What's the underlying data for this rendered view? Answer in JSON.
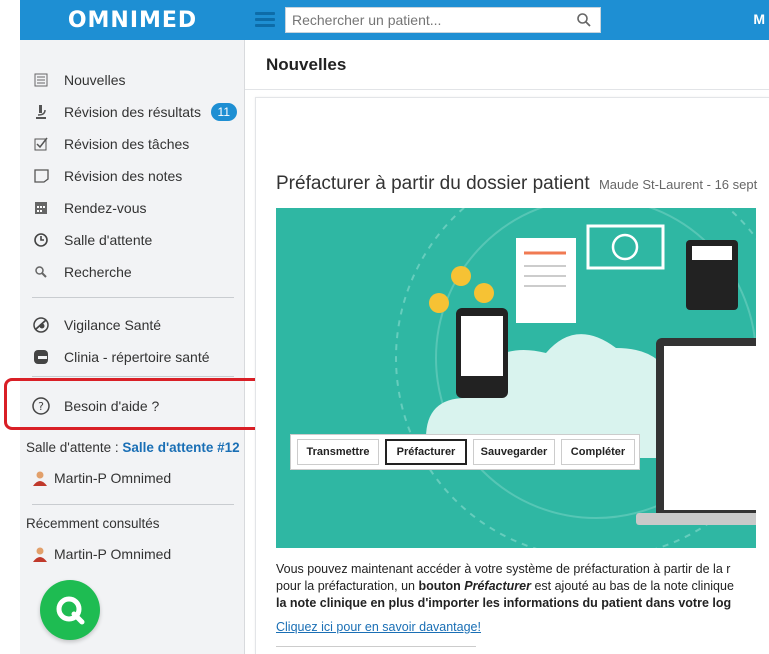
{
  "app": {
    "logo": "OMNIMED",
    "top_right_initial": "M"
  },
  "search": {
    "placeholder": "Rechercher un patient..."
  },
  "sidebar": {
    "items": [
      {
        "label": "Nouvelles",
        "icon": "newspaper-icon"
      },
      {
        "label": "Révision des résultats",
        "icon": "microscope-icon",
        "badge": "11"
      },
      {
        "label": "Révision des tâches",
        "icon": "checkbox-icon"
      },
      {
        "label": "Révision des notes",
        "icon": "note-icon"
      },
      {
        "label": "Rendez-vous",
        "icon": "calendar-icon"
      },
      {
        "label": "Salle d'attente",
        "icon": "clock-icon"
      },
      {
        "label": "Recherche",
        "icon": "search-icon"
      }
    ],
    "items2": [
      {
        "label": "Vigilance Santé",
        "icon": "vigilance-icon"
      },
      {
        "label": "Clinia - répertoire santé",
        "icon": "clinia-icon"
      }
    ],
    "help": {
      "label": "Besoin d'aide ?"
    },
    "waiting_room": {
      "label": "Salle d'attente :",
      "value": "Salle d'attente #12",
      "person": "Martin-P Omnimed"
    },
    "recent": {
      "label": "Récemment consultés",
      "person": "Martin-P Omnimed"
    }
  },
  "main": {
    "title": "Nouvelles",
    "article": {
      "title": "Préfacturer à partir du dossier patient",
      "meta": "Maude St-Laurent - 16 sept",
      "hero_buttons": [
        "Transmettre",
        "Préfacturer",
        "Sauvegarder",
        "Compléter"
      ],
      "body_line1": "Vous pouvez maintenant accéder à votre système de préfacturation à partir de la r",
      "body_line2_a": "pour la préfacturation, un ",
      "body_line2_b": "bouton ",
      "body_line2_c": "Préfacturer",
      "body_line2_d": " est ajouté au bas de la note clinique",
      "body_line3": "la note clinique en plus d'importer les informations du patient dans votre log",
      "link": "Cliquez ici pour en savoir davantage!"
    }
  },
  "colors": {
    "brand": "#1e8fd3",
    "highlight": "#d91f26",
    "chat": "#1ebc52",
    "hero_bg": "#2fb7a3"
  }
}
